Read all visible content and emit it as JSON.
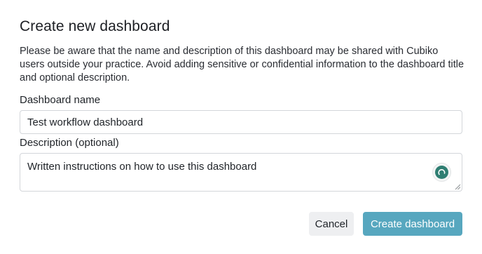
{
  "dialog": {
    "title": "Create new dashboard",
    "notice": "Please be aware that the name and description of this dashboard may be shared with Cubiko users outside your practice. Avoid adding sensitive or confidential information to the dashboard title and optional description."
  },
  "form": {
    "name_label": "Dashboard name",
    "name_value": "Test workflow dashboard",
    "description_label": "Description (optional)",
    "description_value": "Written instructions on how to use this dashboard"
  },
  "actions": {
    "cancel_label": "Cancel",
    "create_label": "Create dashboard"
  },
  "colors": {
    "primary_button": "#57a7bf",
    "secondary_button": "#eeeff1",
    "grammar_icon": "#2f7e72"
  },
  "icons": {
    "assistant": "grammar-assistant-icon",
    "resize": "resize-grip-icon"
  }
}
